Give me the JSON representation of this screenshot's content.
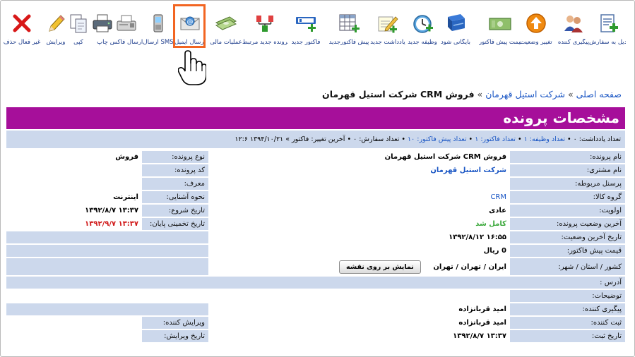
{
  "toolbar": {
    "items": [
      {
        "label": "تبدیل به سفارش",
        "icon": "document-add-icon"
      },
      {
        "label": "پیگیری کننده",
        "icon": "users-icon"
      },
      {
        "label": "تغییر وضعیت",
        "icon": "orange-up-arrow-icon"
      },
      {
        "label": "قیمت پیش فاکتور",
        "icon": "banknote-icon"
      },
      {
        "label": "بایگانی شود",
        "icon": "archive-book-icon"
      },
      {
        "label": "وظیفه جدید",
        "icon": "alarm-clock-icon"
      },
      {
        "label": "یادداشت جدید",
        "icon": "note-pencil-icon"
      },
      {
        "label": "پیش فاکتورجدید",
        "icon": "table-add-icon"
      },
      {
        "label": "فاکتور جدید",
        "icon": "invoice-icon"
      },
      {
        "label": "پرونده جدید مرتبط",
        "icon": "connection-nodes-icon"
      },
      {
        "label": "عملیات مالی",
        "icon": "money-stack-icon"
      },
      {
        "label": "ارسال ایمیل",
        "icon": "email-icon"
      },
      {
        "label": "ارسال SMS",
        "icon": "mobile-phone-icon"
      },
      {
        "label": "ارسال فاکس",
        "icon": "fax-icon"
      },
      {
        "label": "چاپ",
        "icon": "printer-icon"
      },
      {
        "label": "کپی",
        "icon": "copy-icon"
      },
      {
        "label": "ویرایش",
        "icon": "pencil-icon"
      },
      {
        "label": "غیر فعال حذف",
        "icon": "red-x-icon"
      }
    ]
  },
  "breadcrumb": {
    "home": "صفحه اصلی",
    "separator": "»",
    "customer": "شرکت استیل قهرمان",
    "current": "فروش CRM شرکت استیل قهرمان"
  },
  "header": {
    "title": "مشخصات پرونده"
  },
  "stats": {
    "notes": "تعداد یادداشت: ۰",
    "tasks": "تعداد وظیفه: ۱",
    "invoices": "تعداد فاکتور: ۱",
    "proformas": "تعداد پیش فاکتور: ۱۰",
    "orders": "تعداد سفارش: ۰",
    "last_change": "آخرین تغییر: فاکتور » ۱۳۹۴/۱۰/۲۱ ۱۲:۶"
  },
  "details": {
    "case_name_label": "نام پرونده:",
    "case_name": "فروش CRM شرکت استیل قهرمان",
    "case_type_label": "نوع پرونده:",
    "case_type": "فروش",
    "customer_label": "نام مشتری:",
    "customer": "شرکت استیل قهرمان",
    "case_code_label": "کد پرونده:",
    "staff_label": "پرسنل مربوطه:",
    "referrer_label": "معرف:",
    "product_group_label": "گروه کالا:",
    "product_group": "CRM",
    "acquaintance_label": "نحوه آشنایی:",
    "acquaintance": "اینترنت",
    "priority_label": "اولویت:",
    "priority": "عادی",
    "start_date_label": "تاریخ شروع:",
    "start_date": "۱۳:۳۷ ۱۳۹۲/۸/۷",
    "last_status_label": "آخرین وضعیت پرونده:",
    "last_status": "کامل شد",
    "est_end_label": "تاریخ تخمینی پایان:",
    "est_end": "۱۳:۳۷ ۱۳۹۲/۹/۷",
    "last_status_date_label": "تاریخ آخرین وضعیت:",
    "last_status_date": "۱۶:۵۵ ۱۳۹۲/۸/۱۲",
    "proforma_price_label": "قیمت پیش فاکتور:",
    "proforma_price": "0 ریال",
    "location_label": "کشور / استان / شهر:",
    "location": "ایران / تهران / تهران",
    "map_button": "نمایش بر روی نقشه",
    "address_label": "آدرس :",
    "description_label": "توضیحات:",
    "follower_label": "پیگیری کننده:",
    "follower": "امید قربانزاده",
    "registrar_label": "ثبت کننده:",
    "registrar": "امید قربانزاده",
    "editor_label": "ویرایش کننده:",
    "reg_date_label": "تاریخ ثبت:",
    "reg_date": "۱۳:۳۷ ۱۳۹۲/۸/۷",
    "edit_date_label": "تاریخ ویرایش:"
  },
  "colors": {
    "header_bg": "#a60f9a",
    "row_bg": "#ccd8ec",
    "link": "#1a56c4",
    "highlight": "#f26522"
  }
}
